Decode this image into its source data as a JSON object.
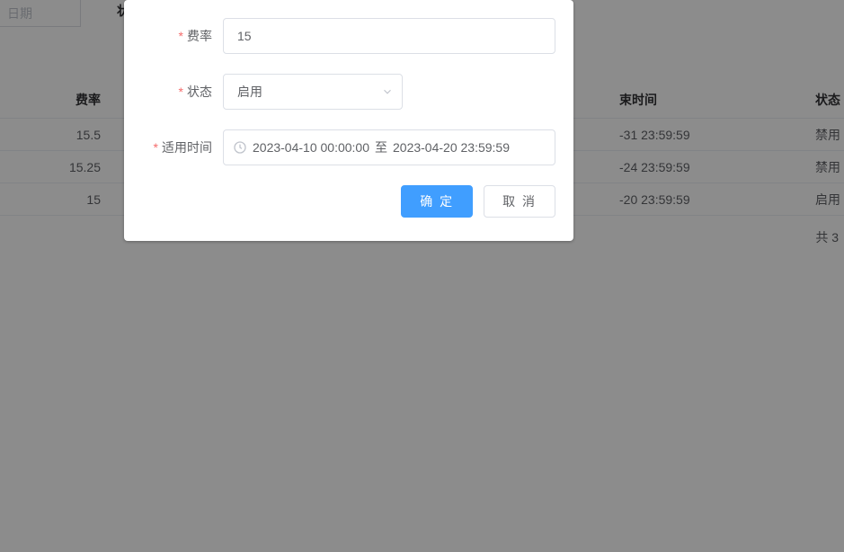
{
  "top": {
    "date_placeholder": "日期",
    "state_fragment": "状"
  },
  "table": {
    "headers": {
      "rate": "费率",
      "end_time": "束时间",
      "status": "状态"
    },
    "rows": [
      {
        "rate": "15.5",
        "end_time": "-31 23:59:59",
        "status": "禁用"
      },
      {
        "rate": "15.25",
        "end_time": "-24 23:59:59",
        "status": "禁用"
      },
      {
        "rate": "15",
        "end_time": "-20 23:59:59",
        "status": "启用"
      }
    ],
    "footer_total": "共 3"
  },
  "modal": {
    "fields": {
      "rate": {
        "label": "费率",
        "value": "15"
      },
      "status": {
        "label": "状态",
        "value": "启用"
      },
      "period": {
        "label": "适用时间",
        "start": "2023-04-10 00:00:00",
        "sep": "至",
        "end": "2023-04-20 23:59:59"
      }
    },
    "buttons": {
      "confirm": "确 定",
      "cancel": "取 消"
    }
  }
}
